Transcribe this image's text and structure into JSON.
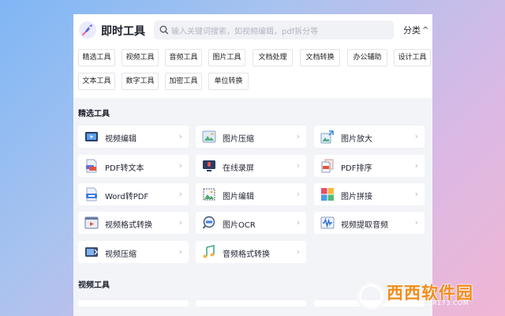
{
  "header": {
    "app_title": "即时工具",
    "search_placeholder": "输入关键词搜索，如视频编辑，pdf拆分等",
    "classify_label": "分类"
  },
  "categories": [
    "精选工具",
    "视频工具",
    "音频工具",
    "图片工具",
    "文档处理",
    "文档转换",
    "办公辅助",
    "设计工具",
    "文本工具",
    "数字工具",
    "加密工具",
    "单位转换"
  ],
  "sections": {
    "featured_title": "精选工具",
    "video_title": "视频工具"
  },
  "tools": [
    {
      "label": "视频编辑",
      "icon": "video-edit-icon"
    },
    {
      "label": "图片压缩",
      "icon": "image-compress-icon"
    },
    {
      "label": "图片放大",
      "icon": "image-enlarge-icon"
    },
    {
      "label": "PDF转文本",
      "icon": "pdf-to-text-icon"
    },
    {
      "label": "在线录屏",
      "icon": "screen-record-icon"
    },
    {
      "label": "PDF排序",
      "icon": "pdf-sort-icon"
    },
    {
      "label": "Word转PDF",
      "icon": "word-to-pdf-icon"
    },
    {
      "label": "图片编辑",
      "icon": "image-edit-icon"
    },
    {
      "label": "图片拼接",
      "icon": "image-collage-icon"
    },
    {
      "label": "视频格式转换",
      "icon": "video-convert-icon"
    },
    {
      "label": "图片OCR",
      "icon": "image-ocr-icon"
    },
    {
      "label": "视频提取音频",
      "icon": "extract-audio-icon"
    },
    {
      "label": "视频压缩",
      "icon": "video-compress-icon"
    },
    {
      "label": "音频格式转换",
      "icon": "audio-convert-icon"
    }
  ],
  "arrow_glyph": "›",
  "watermark": {
    "brand": "西西软件园",
    "site": "CR173.COM"
  }
}
